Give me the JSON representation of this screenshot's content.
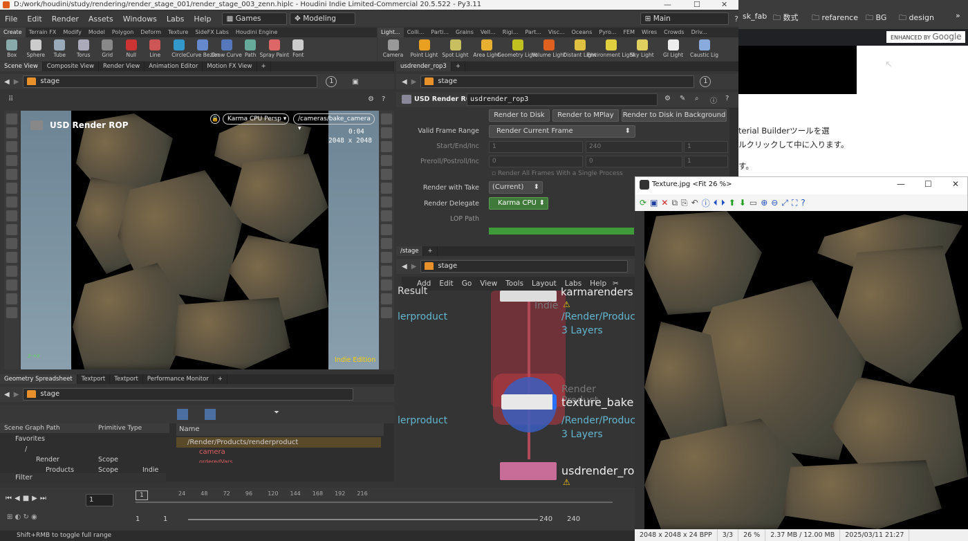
{
  "houdini": {
    "title": "D:/work/houdini/study/rendering/render_stage_001/render_stage_003_zenn.hiplc - Houdini Indie Limited-Commercial 20.5.522 - Py3.11",
    "menu": [
      "File",
      "Edit",
      "Render",
      "Assets",
      "Windows",
      "Labs",
      "Help"
    ],
    "desktop_combo": "Games",
    "mode_combo": "Modeling",
    "main_combo": "Main",
    "shelf_tabs_left": [
      "Create",
      "Terrain FX",
      "Modify",
      "Model",
      "Polygon",
      "Deform",
      "Texture",
      "SideFX Labs",
      "Houdini Engine"
    ],
    "shelf_tabs_right": [
      "Light...",
      "Colli...",
      "Parti...",
      "Grains",
      "Vell...",
      "Rigi...",
      "Part...",
      "Visc...",
      "Oceans",
      "Pyro...",
      "FEM",
      "Wires",
      "Crowds",
      "Driv..."
    ],
    "create_tools": [
      "Box",
      "Sphere",
      "Tube",
      "Torus",
      "Grid",
      "Null",
      "Line",
      "Circle",
      "Curve Bezier",
      "Draw Curve",
      "Path",
      "Spray Paint",
      "Font"
    ],
    "light_tools": [
      "Camera",
      "Point Light",
      "Spot Light",
      "Area Light",
      "Geometry Light",
      "Volume Light",
      "Distant Light",
      "Environment Light",
      "Sky Light",
      "GI Light",
      "Caustic Lig"
    ],
    "scene_tabs": [
      "Scene View",
      "Composite View",
      "Render View",
      "Animation Editor",
      "Motion FX View"
    ],
    "scene_path": "stage",
    "viewport": {
      "title": "USD Render ROP",
      "renderer": "Karma CPU",
      "persp": "Persp",
      "camera": "/cameras/bake_camera",
      "time": "0:04",
      "resolution": "2048 x 2048",
      "edition": "Indie Edition"
    },
    "param_tab": "usdrender_rop3",
    "param_path": "stage",
    "node_type": "USD Render ROP",
    "node_name": "usdrender_rop3",
    "render_buttons": [
      "Render to Disk",
      "Render to MPlay",
      "Render to Disk in Background"
    ],
    "params": {
      "valid_frame_range_label": "Valid Frame Range",
      "valid_frame_range": "Render Current Frame",
      "start_end_label": "Start/End/Inc",
      "start_end": [
        "1",
        "240",
        "1"
      ],
      "preroll_label": "Preroll/Postroll/Inc",
      "preroll": [
        "0",
        "0",
        "1"
      ],
      "all_frames_label": "Render All Frames With a Single Process",
      "take_label": "Render with Take",
      "take": "(Current)",
      "delegate_label": "Render Delegate",
      "delegate": "Karma CPU",
      "lop_path_label": "LOP Path"
    },
    "network_tab": "/stage",
    "network_path": "stage",
    "network_menu": [
      "Add",
      "Edit",
      "Go",
      "View",
      "Tools",
      "Layout",
      "Labs",
      "Help"
    ],
    "nodes": {
      "result_label": "Result",
      "renderproduct1": "lerproduct",
      "renderproduct2": "lerproduct",
      "karma_name": "karmarenders",
      "karma_sub": "Indie",
      "karma_path": "/Render/Produc",
      "karma_layers": "3 Layers",
      "tex_type": "Render Product",
      "tex_name": "texture_bake",
      "tex_path": "/Render/Produc",
      "tex_layers": "3 Layers",
      "rop_name": "usdrender_rop"
    },
    "bottom_tabs": [
      "Geometry Spreadsheet",
      "Textport",
      "Textport",
      "Performance Monitor"
    ],
    "bottom_path": "stage",
    "ss_headers": [
      "Scene Graph Path",
      "Primitive Type"
    ],
    "ss_rows": [
      {
        "path": "Favorites",
        "type": ""
      },
      {
        "path": "/",
        "type": ""
      },
      {
        "path": "Render",
        "type": "Scope"
      },
      {
        "path": "Products",
        "type": "Scope"
      }
    ],
    "ss_extra": "Indie",
    "filter_label": "Filter",
    "name_header": "Name",
    "name_rows": [
      "/Render/Products/renderproduct",
      "camera",
      "orderedVars"
    ],
    "timeline_ticks": [
      "24",
      "48",
      "72",
      "96",
      "120",
      "144",
      "168",
      "192",
      "216"
    ],
    "frame_current": "1",
    "frame_marker": "1",
    "range_start": "1",
    "range_start2": "1",
    "range_end": "240",
    "range_end2": "240",
    "status": "Shift+RMB to toggle full range"
  },
  "browser": {
    "bookmarks": [
      "sk_fab",
      "数式",
      "refarence",
      "BG",
      "design"
    ],
    "enhanced": "ENHANCED BY",
    "google": "Google",
    "text1": "terial Builderツールを選",
    "text2": "ルクリックして中に入ります。",
    "text3": "す。"
  },
  "viewer": {
    "title": "Texture.jpg <Fit 26 %>",
    "status": [
      "2048 x 2048 x 24 BPP",
      "3/3",
      "26 %",
      "2.37 MB / 12.00 MB",
      "2025/03/11 21:27"
    ]
  }
}
